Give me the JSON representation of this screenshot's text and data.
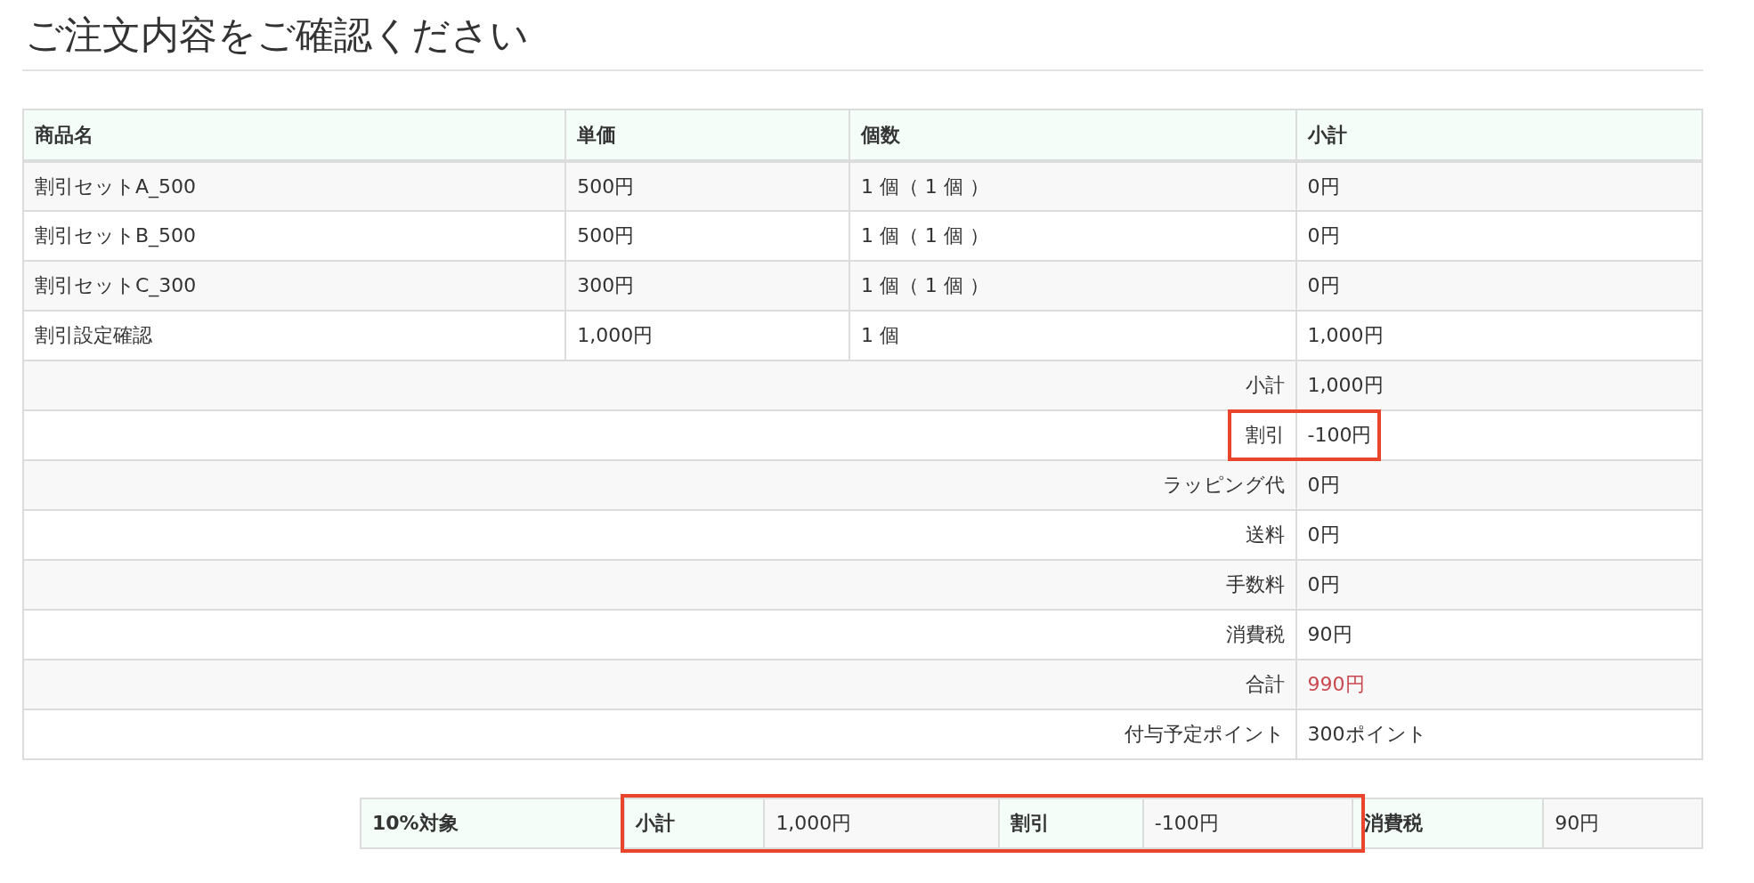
{
  "page_title": "ご注文内容をご確認ください",
  "order_table": {
    "columns": [
      "商品名",
      "単価",
      "個数",
      "小計"
    ],
    "rows": [
      {
        "cells": [
          "割引セットA_500",
          "500円",
          "1 個（ 1 個 ）",
          "0円"
        ]
      },
      {
        "cells": [
          "割引セットB_500",
          "500円",
          "1 個（ 1 個 ）",
          "0円"
        ]
      },
      {
        "cells": [
          "割引セットC_300",
          "300円",
          "1 個（ 1 個 ）",
          "0円"
        ]
      },
      {
        "cells": [
          "割引設定確認",
          "1,000円",
          "1 個",
          "1,000円"
        ]
      }
    ],
    "summary": [
      {
        "label": "小計",
        "value": "1,000円",
        "highlighted": false,
        "emphasized": false
      },
      {
        "label": "割引",
        "value": "-100円",
        "highlighted": true,
        "emphasized": false
      },
      {
        "label": "ラッピング代",
        "value": "0円",
        "highlighted": false,
        "emphasized": false
      },
      {
        "label": "送料",
        "value": "0円",
        "highlighted": false,
        "emphasized": false
      },
      {
        "label": "手数料",
        "value": "0円",
        "highlighted": false,
        "emphasized": false
      },
      {
        "label": "消費税",
        "value": "90円",
        "highlighted": false,
        "emphasized": false
      },
      {
        "label": "合計",
        "value": "990円",
        "highlighted": false,
        "emphasized": true
      },
      {
        "label": "付与予定ポイント",
        "value": "300ポイント",
        "highlighted": false,
        "emphasized": false
      }
    ]
  },
  "tax_table": {
    "cells": [
      {
        "kind": "label",
        "text": "10%対象",
        "highlighted": false
      },
      {
        "kind": "label",
        "text": "小計",
        "highlighted": true
      },
      {
        "kind": "value",
        "text": "1,000円",
        "highlighted": true
      },
      {
        "kind": "label",
        "text": "割引",
        "highlighted": true
      },
      {
        "kind": "value",
        "text": "-100円",
        "highlighted": true
      },
      {
        "kind": "label",
        "text": "消費税",
        "highlighted": false
      },
      {
        "kind": "value",
        "text": "90円",
        "highlighted": false
      }
    ]
  }
}
